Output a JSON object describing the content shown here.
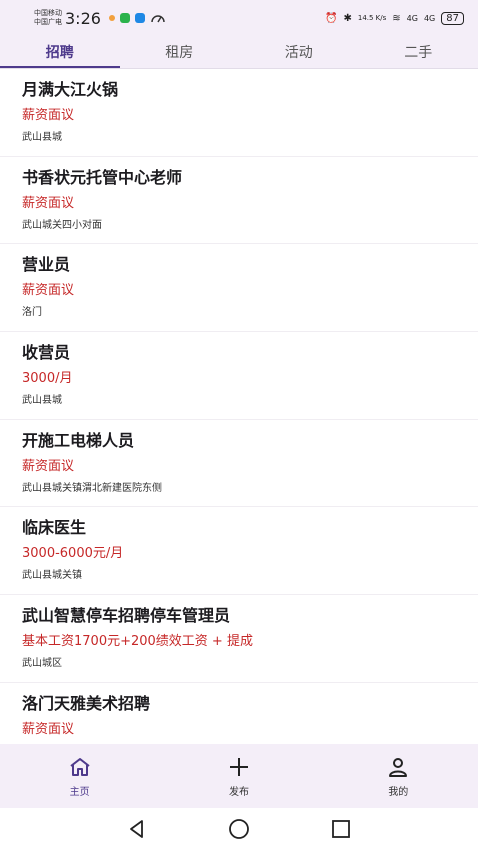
{
  "status_bar": {
    "carrier_1": "中国移动",
    "carrier_2": "中国广电",
    "time": "3:26",
    "net_speed": "14.5 K/s",
    "signal_1": "4G",
    "signal_2": "4G",
    "battery": "87"
  },
  "tabs": [
    {
      "label": "招聘",
      "active": true
    },
    {
      "label": "租房",
      "active": false
    },
    {
      "label": "活动",
      "active": false
    },
    {
      "label": "二手",
      "active": false
    }
  ],
  "jobs": [
    {
      "title": "月满大江火锅",
      "salary": "薪资面议",
      "location": "武山县城"
    },
    {
      "title": "书香状元托管中心老师",
      "salary": "薪资面议",
      "location": "武山城关四小对面"
    },
    {
      "title": "营业员",
      "salary": "薪资面议",
      "location": "洛门"
    },
    {
      "title": "收营员",
      "salary": "3000/月",
      "location": "武山县城"
    },
    {
      "title": "开施工电梯人员",
      "salary": "薪资面议",
      "location": "武山县城关镇渭北新建医院东侧"
    },
    {
      "title": "临床医生",
      "salary": "3000-6000元/月",
      "location": "武山县城关镇"
    },
    {
      "title": "武山智慧停车招聘停车管理员",
      "salary": "基本工资1700元+200绩效工资 + 提成",
      "location": "武山城区"
    },
    {
      "title": "洛门天雅美术招聘",
      "salary": "薪资面议",
      "location": ""
    }
  ],
  "bottom_nav": {
    "home": {
      "label": "主页",
      "icon": "home-icon"
    },
    "publish": {
      "label": "发布",
      "icon": "plus-icon"
    },
    "mine": {
      "label": "我的",
      "icon": "person-icon"
    }
  },
  "colors": {
    "accent": "#4e3a8c",
    "salary": "#c62828",
    "bar_bg": "#f4eef8"
  }
}
